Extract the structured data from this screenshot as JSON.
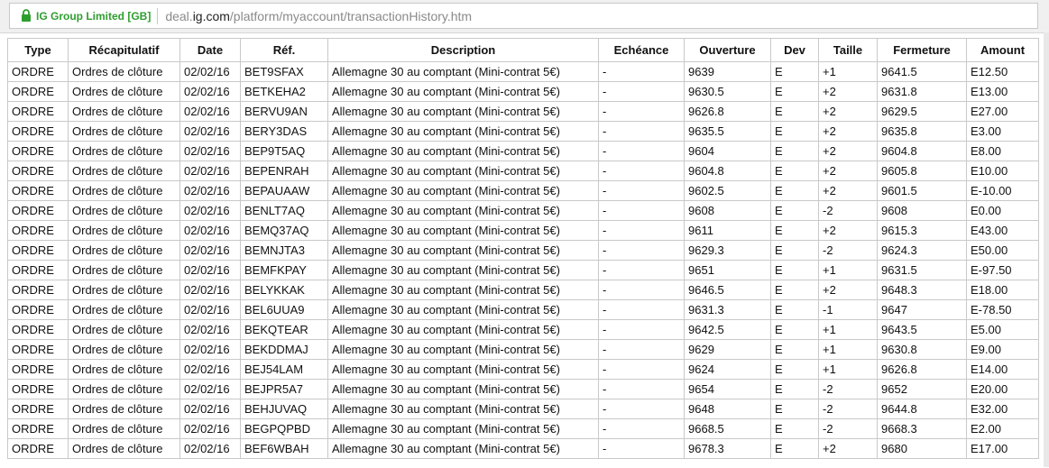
{
  "browser": {
    "identity": "IG Group Limited [GB]",
    "url_host": "deal.",
    "url_domain": "ig.com",
    "url_path": "/platform/myaccount/transactionHistory.htm"
  },
  "table": {
    "headers": [
      "Type",
      "Récapitulatif",
      "Date",
      "Réf.",
      "Description",
      "Echéance",
      "Ouverture",
      "Dev",
      "Taille",
      "Fermeture",
      "Amount"
    ],
    "rows": [
      [
        "ORDRE",
        "Ordres de clôture",
        "02/02/16",
        "BET9SFAX",
        "Allemagne 30 au comptant (Mini-contrat 5€)",
        "-",
        "9639",
        "E",
        "+1",
        "9641.5",
        "E12.50"
      ],
      [
        "ORDRE",
        "Ordres de clôture",
        "02/02/16",
        "BETKEHA2",
        "Allemagne 30 au comptant (Mini-contrat 5€)",
        "-",
        "9630.5",
        "E",
        "+2",
        "9631.8",
        "E13.00"
      ],
      [
        "ORDRE",
        "Ordres de clôture",
        "02/02/16",
        "BERVU9AN",
        "Allemagne 30 au comptant (Mini-contrat 5€)",
        "-",
        "9626.8",
        "E",
        "+2",
        "9629.5",
        "E27.00"
      ],
      [
        "ORDRE",
        "Ordres de clôture",
        "02/02/16",
        "BERY3DAS",
        "Allemagne 30 au comptant (Mini-contrat 5€)",
        "-",
        "9635.5",
        "E",
        "+2",
        "9635.8",
        "E3.00"
      ],
      [
        "ORDRE",
        "Ordres de clôture",
        "02/02/16",
        "BEP9T5AQ",
        "Allemagne 30 au comptant (Mini-contrat 5€)",
        "-",
        "9604",
        "E",
        "+2",
        "9604.8",
        "E8.00"
      ],
      [
        "ORDRE",
        "Ordres de clôture",
        "02/02/16",
        "BEPENRAH",
        "Allemagne 30 au comptant (Mini-contrat 5€)",
        "-",
        "9604.8",
        "E",
        "+2",
        "9605.8",
        "E10.00"
      ],
      [
        "ORDRE",
        "Ordres de clôture",
        "02/02/16",
        "BEPAUAAW",
        "Allemagne 30 au comptant (Mini-contrat 5€)",
        "-",
        "9602.5",
        "E",
        "+2",
        "9601.5",
        "E-10.00"
      ],
      [
        "ORDRE",
        "Ordres de clôture",
        "02/02/16",
        "BENLT7AQ",
        "Allemagne 30 au comptant (Mini-contrat 5€)",
        "-",
        "9608",
        "E",
        "-2",
        "9608",
        "E0.00"
      ],
      [
        "ORDRE",
        "Ordres de clôture",
        "02/02/16",
        "BEMQ37AQ",
        "Allemagne 30 au comptant (Mini-contrat 5€)",
        "-",
        "9611",
        "E",
        "+2",
        "9615.3",
        "E43.00"
      ],
      [
        "ORDRE",
        "Ordres de clôture",
        "02/02/16",
        "BEMNJTA3",
        "Allemagne 30 au comptant (Mini-contrat 5€)",
        "-",
        "9629.3",
        "E",
        "-2",
        "9624.3",
        "E50.00"
      ],
      [
        "ORDRE",
        "Ordres de clôture",
        "02/02/16",
        "BEMFKPAY",
        "Allemagne 30 au comptant (Mini-contrat 5€)",
        "-",
        "9651",
        "E",
        "+1",
        "9631.5",
        "E-97.50"
      ],
      [
        "ORDRE",
        "Ordres de clôture",
        "02/02/16",
        "BELYKKAK",
        "Allemagne 30 au comptant (Mini-contrat 5€)",
        "-",
        "9646.5",
        "E",
        "+2",
        "9648.3",
        "E18.00"
      ],
      [
        "ORDRE",
        "Ordres de clôture",
        "02/02/16",
        "BEL6UUA9",
        "Allemagne 30 au comptant (Mini-contrat 5€)",
        "-",
        "9631.3",
        "E",
        "-1",
        "9647",
        "E-78.50"
      ],
      [
        "ORDRE",
        "Ordres de clôture",
        "02/02/16",
        "BEKQTEAR",
        "Allemagne 30 au comptant (Mini-contrat 5€)",
        "-",
        "9642.5",
        "E",
        "+1",
        "9643.5",
        "E5.00"
      ],
      [
        "ORDRE",
        "Ordres de clôture",
        "02/02/16",
        "BEKDDMAJ",
        "Allemagne 30 au comptant (Mini-contrat 5€)",
        "-",
        "9629",
        "E",
        "+1",
        "9630.8",
        "E9.00"
      ],
      [
        "ORDRE",
        "Ordres de clôture",
        "02/02/16",
        "BEJ54LAM",
        "Allemagne 30 au comptant (Mini-contrat 5€)",
        "-",
        "9624",
        "E",
        "+1",
        "9626.8",
        "E14.00"
      ],
      [
        "ORDRE",
        "Ordres de clôture",
        "02/02/16",
        "BEJPR5A7",
        "Allemagne 30 au comptant (Mini-contrat 5€)",
        "-",
        "9654",
        "E",
        "-2",
        "9652",
        "E20.00"
      ],
      [
        "ORDRE",
        "Ordres de clôture",
        "02/02/16",
        "BEHJUVAQ",
        "Allemagne 30 au comptant (Mini-contrat 5€)",
        "-",
        "9648",
        "E",
        "-2",
        "9644.8",
        "E32.00"
      ],
      [
        "ORDRE",
        "Ordres de clôture",
        "02/02/16",
        "BEGPQPBD",
        "Allemagne 30 au comptant (Mini-contrat 5€)",
        "-",
        "9668.5",
        "E",
        "-2",
        "9668.3",
        "E2.00"
      ],
      [
        "ORDRE",
        "Ordres de clôture",
        "02/02/16",
        "BEF6WBAH",
        "Allemagne 30 au comptant (Mini-contrat 5€)",
        "-",
        "9678.3",
        "E",
        "+2",
        "9680",
        "E17.00"
      ]
    ]
  },
  "colors": {
    "secure": "#2e9e2e",
    "border": "#c9c9c9"
  },
  "icons": {
    "lock": "lock-icon"
  }
}
